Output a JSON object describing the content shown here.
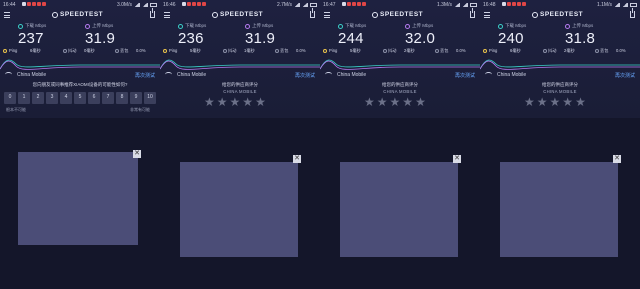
{
  "panels": [
    {
      "time": "16:44",
      "net_speed": "3.0M/s",
      "brand": "SPEEDTEST",
      "download": {
        "label": "下载 Mbps",
        "value": "237"
      },
      "upload": {
        "label": "上传 Mbps",
        "value": "31.9"
      },
      "ping": {
        "label": "Ping",
        "value": "6毫秒"
      },
      "jitter": {
        "label": "抖动",
        "value": "0毫秒"
      },
      "loss": {
        "label": "丢包",
        "value": "0.0%"
      },
      "carrier": "China Mobile",
      "retest": "再次测试",
      "question": "您向朋友或同事推荐XIAOMI设备的可能性如何?",
      "nps": [
        "0",
        "1",
        "2",
        "3",
        "4",
        "5",
        "6",
        "7",
        "8",
        "9",
        "10"
      ],
      "nps_low": "根本不可能",
      "nps_high": "非常有可能",
      "close": "✕"
    },
    {
      "time": "16:46",
      "net_speed": "2.7M/s",
      "brand": "SPEEDTEST",
      "download": {
        "label": "下载 Mbps",
        "value": "236"
      },
      "upload": {
        "label": "上传 Mbps",
        "value": "31.9"
      },
      "ping": {
        "label": "Ping",
        "value": "5毫秒"
      },
      "jitter": {
        "label": "抖动",
        "value": "1毫秒"
      },
      "loss": {
        "label": "丢包",
        "value": "0.0%"
      },
      "carrier": "China Mobile",
      "retest": "再次测试",
      "question": "给您的供应商评分",
      "operator": "CHINA MOBILE",
      "stars": [
        "★",
        "★",
        "★",
        "★",
        "★"
      ],
      "close": "✕"
    },
    {
      "time": "16:47",
      "net_speed": "1.3M/s",
      "brand": "SPEEDTEST",
      "download": {
        "label": "下载 Mbps",
        "value": "244"
      },
      "upload": {
        "label": "上传 Mbps",
        "value": "32.0"
      },
      "ping": {
        "label": "Ping",
        "value": "5毫秒"
      },
      "jitter": {
        "label": "抖动",
        "value": "2毫秒"
      },
      "loss": {
        "label": "丢包",
        "value": "0.0%"
      },
      "carrier": "China Mobile",
      "retest": "再次测试",
      "question": "给您的供应商评分",
      "operator": "CHINA MOBILE",
      "stars": [
        "★",
        "★",
        "★",
        "★",
        "★"
      ],
      "close": "✕"
    },
    {
      "time": "16:48",
      "net_speed": "1.1M/s",
      "brand": "SPEEDTEST",
      "download": {
        "label": "下载 Mbps",
        "value": "240"
      },
      "upload": {
        "label": "上传 Mbps",
        "value": "31.8"
      },
      "ping": {
        "label": "Ping",
        "value": "6毫秒"
      },
      "jitter": {
        "label": "抖动",
        "value": "2毫秒"
      },
      "loss": {
        "label": "丢包",
        "value": "0.0%"
      },
      "carrier": "China Mobile",
      "retest": "再次测试",
      "question": "给您的供应商评分",
      "operator": "CHINA MOBILE",
      "stars": [
        "★",
        "★",
        "★",
        "★",
        "★"
      ],
      "close": "✕"
    }
  ],
  "colors": {
    "download_ring": "#3ad0c8",
    "upload_ring": "#b57af0",
    "retest_link": "#6aa8ff",
    "ad_placeholder": "#4b4d77",
    "star_empty": "#6b7088"
  }
}
